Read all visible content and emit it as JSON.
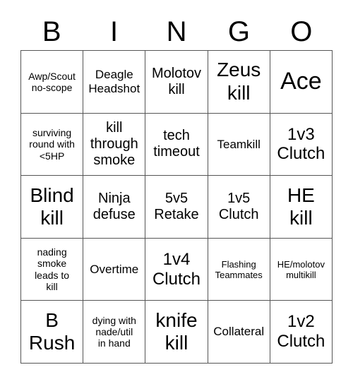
{
  "card": {
    "headers": [
      "B",
      "I",
      "N",
      "G",
      "O"
    ],
    "rows": [
      [
        {
          "text": "Awp/Scout\nno-scope",
          "size": "fs-sm"
        },
        {
          "text": "Deagle\nHeadshot",
          "size": "fs-md"
        },
        {
          "text": "Molotov\nkill",
          "size": "fs-lg"
        },
        {
          "text": "Zeus\nkill",
          "size": "fs-2xl"
        },
        {
          "text": "Ace",
          "size": "fs-3xl"
        }
      ],
      [
        {
          "text": "surviving\nround with\n<5HP",
          "size": "fs-sm"
        },
        {
          "text": "kill\nthrough\nsmoke",
          "size": "fs-lg"
        },
        {
          "text": "tech\ntimeout",
          "size": "fs-lg"
        },
        {
          "text": "Teamkill",
          "size": "fs-md"
        },
        {
          "text": "1v3\nClutch",
          "size": "fs-xl"
        }
      ],
      [
        {
          "text": "Blind\nkill",
          "size": "fs-2xl"
        },
        {
          "text": "Ninja\ndefuse",
          "size": "fs-lg"
        },
        {
          "text": "5v5\nRetake",
          "size": "fs-lg"
        },
        {
          "text": "1v5\nClutch",
          "size": "fs-lg"
        },
        {
          "text": "HE\nkill",
          "size": "fs-2xl"
        }
      ],
      [
        {
          "text": "nading\nsmoke\nleads to\nkill",
          "size": "fs-sm"
        },
        {
          "text": "Overtime",
          "size": "fs-md"
        },
        {
          "text": "1v4\nClutch",
          "size": "fs-xl"
        },
        {
          "text": "Flashing\nTeammates",
          "size": "fs-xs"
        },
        {
          "text": "HE/molotov\nmultikill",
          "size": "fs-xs"
        }
      ],
      [
        {
          "text": "B\nRush",
          "size": "fs-2xl"
        },
        {
          "text": "dying with\nnade/util\nin hand",
          "size": "fs-sm"
        },
        {
          "text": "knife\nkill",
          "size": "fs-2xl"
        },
        {
          "text": "Collateral",
          "size": "fs-md"
        },
        {
          "text": "1v2\nClutch",
          "size": "fs-xl"
        }
      ]
    ]
  },
  "colors": {
    "background": "#ffffff",
    "text": "#000000",
    "border": "#555555"
  }
}
